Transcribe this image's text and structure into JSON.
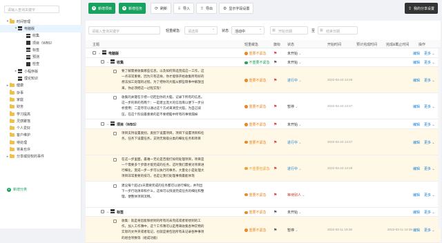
{
  "sidebar": {
    "search_placeholder": "请输入查询关键字",
    "tree": [
      {
        "label": "时间管理",
        "kind": "folder",
        "caret": "▾",
        "level": 0
      },
      {
        "label": "电脑版",
        "kind": "grid",
        "caret": "▾",
        "level": 1,
        "selected": true
      },
      {
        "label": "收集",
        "kind": "grid",
        "caret": "",
        "level": 2
      },
      {
        "label": "项目（WBS）",
        "kind": "grid",
        "caret": "",
        "level": 2
      },
      {
        "label": "标签",
        "kind": "grid",
        "caret": "",
        "level": 2
      },
      {
        "label": "预测",
        "kind": "grid",
        "caret": "",
        "level": 2
      },
      {
        "label": "检查",
        "kind": "grid",
        "caret": "",
        "level": 2
      },
      {
        "label": "小程序版",
        "kind": "grid",
        "caret": "▸",
        "level": 1
      },
      {
        "label": "理论知识",
        "kind": "grid",
        "caret": "",
        "level": 1
      },
      {
        "label": "健康",
        "kind": "folder",
        "caret": "▸",
        "level": 0
      },
      {
        "label": "杂事",
        "kind": "folder",
        "caret": "",
        "level": 0
      },
      {
        "label": "家庭",
        "kind": "folder",
        "caret": "",
        "level": 0
      },
      {
        "label": "财务",
        "kind": "folder",
        "caret": "",
        "level": 0
      },
      {
        "label": "学习提高",
        "kind": "folder",
        "caret": "",
        "level": 0
      },
      {
        "label": "灵感聚落",
        "kind": "folder",
        "caret": "",
        "level": 0
      },
      {
        "label": "个人爱好",
        "kind": "folder",
        "caret": "",
        "level": 0
      },
      {
        "label": "客户维护",
        "kind": "folder",
        "caret": "",
        "level": 0
      },
      {
        "label": "待处理",
        "kind": "folder",
        "caret": "",
        "level": 0
      },
      {
        "label": "将来也许",
        "kind": "folder",
        "caret": "",
        "level": 0
      },
      {
        "label": "分享或授权的事件",
        "kind": "folder",
        "caret": "▸",
        "level": 0
      }
    ],
    "add_label": "新增分类"
  },
  "toolbar": {
    "new_project": "新增项目",
    "new_task": "新增任务",
    "refresh": "刷新",
    "import": "导入",
    "export": "导出",
    "field_settings": "显示字段设置",
    "my_share": "我的分享设置"
  },
  "filter": {
    "search_placeholder": "请输入查询关键字",
    "priority_label": "轻重缓急:",
    "priority_placeholder": "请选择",
    "status_label": "状态",
    "status_value": "活动中",
    "start_placeholder": "开始日期",
    "to_label": "至",
    "end_placeholder": "结束日期"
  },
  "table": {
    "headers": [
      "主题",
      "轻重缓急",
      "旗标",
      "状态",
      "开始时间",
      "预计完成时间",
      "完成&截止时间",
      "操作"
    ],
    "rows": [
      {
        "type": "group",
        "name": "电脑版",
        "priority": "重要不紧急",
        "pcolor": "#e88a2a",
        "flag": "#e23b3b",
        "status": "未开始",
        "sclass": "",
        "start": "",
        "done": "",
        "edit": "编辑",
        "more": "更多"
      },
      {
        "type": "group",
        "name": "收集",
        "priority": "不重要不紧急",
        "pcolor": "#2aa05a",
        "flag": "#555555",
        "status": "未开始",
        "sclass": "",
        "start": "",
        "done": "",
        "edit": "编辑",
        "more": "更多"
      },
      {
        "type": "task",
        "desc": "要了解需要收集哪些信息，以及如何筛选完成这一工作，这一点非常重要，因为只有这样，你才能够开始收集所有好的想法加工处理的过程。为了把你的大脑从那些琐事中解放出来，你必须把这一过程实现！",
        "priority": "重要不紧急",
        "pcolor": "#e88a2a",
        "flag": "#e23b3b",
        "status": "进行中",
        "sclass": "blue",
        "start": "2022-04-24 13:46",
        "done": "",
        "edit": "编辑",
        "more": "更多",
        "hl": true
      },
      {
        "type": "task",
        "desc": "收集的关键在于把一切赶出你的大脑，记录下所有的信息。这一步的目的有两个：一是建立庞大的信息库以便下一步分析使用；二是尽可以通过这个方式来清空大脑，为自己减压，在这个阶段最重要的是不要把脑中所有的事情漏掉",
        "priority": "重要不紧急",
        "pcolor": "#e88a2a",
        "flag": "#e23b3b",
        "status": "暂停",
        "sclass": "",
        "start": "2022-04-24 13:47",
        "done": "",
        "edit": "编辑",
        "more": "更多",
        "hl": false
      },
      {
        "type": "group",
        "name": "项目（WBS）",
        "priority": "重要不紧急",
        "pcolor": "#e88a2a",
        "flag": "#e23b3b",
        "status": "未开始",
        "sclass": "",
        "start": "",
        "done": "",
        "edit": "编辑",
        "more": "更多"
      },
      {
        "type": "task",
        "desc": "项目支持设置类别，类别下设置项目，项目下设置项目和任务，任务下设置任务，支持无限级分类的细化任务和项目",
        "priority": "重要不紧急",
        "pcolor": "#e88a2a",
        "flag": "#e23b3b",
        "status": "进行中",
        "sclass": "blue",
        "start": "2022-04-24 13:47",
        "done": "",
        "edit": "编辑",
        "more": "更多",
        "hl": true
      },
      {
        "type": "task",
        "desc": "在这一步里面，最难一无论是否能打如何处理项目，项目是一个需要多个步骤才能完成的任务，这时我们需要对项目进行细化，变成一步一步可以执行的事务，大量化小是处理大项目非常重要的技巧，也是让我们处理事情最能体现",
        "priority": "不重要但紧急",
        "pcolor": "#e8a43a",
        "flag": "#e23b3b",
        "status": "进行中",
        "sclass": "blue",
        "start": "2022-04-24 13:49",
        "done": "",
        "edit": "编辑",
        "more": "更多",
        "hl": true
      },
      {
        "type": "task",
        "desc": "建议每个超过2天需要完成的任务都可以进行细化，并列出下一步行动清单和什么，这样可以快速完成任务的细化和整理，便整体项目流畅。",
        "priority": "重要不紧急",
        "pcolor": "#e88a2a",
        "flag": "#e23b3b",
        "status": "等待别人",
        "sclass": "red",
        "start": "",
        "done": "",
        "edit": "编辑",
        "more": "更多",
        "hl": false
      },
      {
        "type": "group",
        "name": "标签",
        "priority": "重要不紧急",
        "pcolor": "#e88a2a",
        "flag": "#555555",
        "status": "未开始",
        "sclass": "",
        "start": "",
        "done": "",
        "edit": "编辑",
        "more": "更多"
      },
      {
        "type": "task",
        "desc": "收集：就是将您能够想到的所有的未完成或者新想到的工作，加入工作簿中，这个工作簿可以是用来收集各种实物的实际的文件夹或者笔记，也就是要包括所有未记录各种事项的组合项数等（组成功能）",
        "priority": "重要不紧急",
        "pcolor": "#e88a2a",
        "flag": "#555555",
        "status": "暂停",
        "sclass": "",
        "start": "2022-03-11 19:38",
        "done": "2022-03-11 19:39",
        "edit": "编辑",
        "more": "更多",
        "hl": true
      }
    ]
  },
  "colors": {
    "brand_green": "#19a15f",
    "link_blue": "#1a7fd6",
    "highlight_row": "#fff8e6",
    "selected_node": "#e8f4ff"
  }
}
